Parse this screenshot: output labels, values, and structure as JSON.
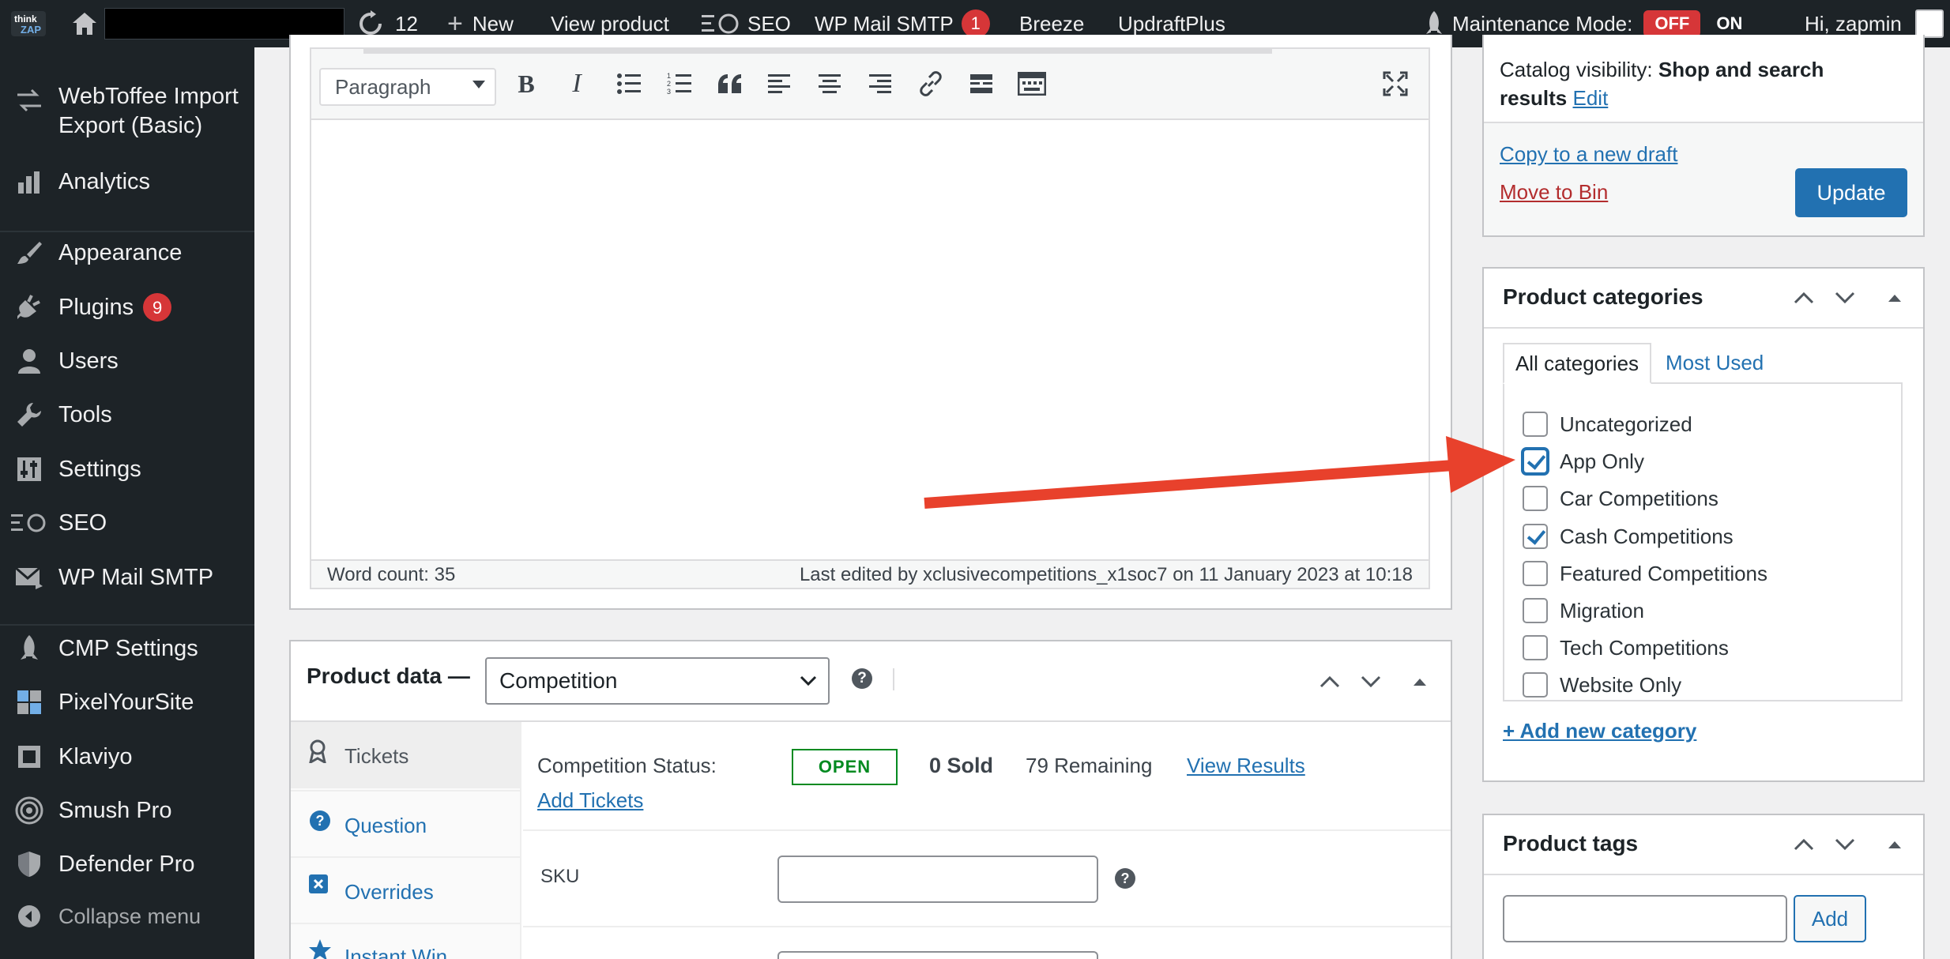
{
  "adminbar": {
    "updates_count": "12",
    "new_label": "New",
    "view_product": "View product",
    "seo": "SEO",
    "wp_mail_smtp": "WP Mail SMTP",
    "smtp_badge": "1",
    "breeze": "Breeze",
    "updraftplus": "UpdraftPlus",
    "maintenance_label": "Maintenance Mode:",
    "maintenance_off": "OFF",
    "maintenance_on": "ON",
    "greeting": "Hi, zapmin"
  },
  "sidebar": {
    "webtoffee_line1": "WebToffee Import",
    "webtoffee_line2": "Export (Basic)",
    "analytics": "Analytics",
    "appearance": "Appearance",
    "plugins": "Plugins",
    "plugins_badge": "9",
    "users": "Users",
    "tools": "Tools",
    "settings": "Settings",
    "seo": "SEO",
    "wp_mail_smtp": "WP Mail SMTP",
    "cmp_settings": "CMP Settings",
    "pixelyoursite": "PixelYourSite",
    "klaviyo": "Klaviyo",
    "smush_pro": "Smush Pro",
    "defender_pro": "Defender Pro",
    "collapse_menu": "Collapse menu"
  },
  "editor": {
    "format_select": "Paragraph",
    "word_count": "Word count: 35",
    "last_edited": "Last edited by xclusivecompetitions_x1soc7 on 11 January 2023 at 10:18"
  },
  "product_data": {
    "title": "Product data —",
    "type_select": "Competition",
    "tabs": {
      "tickets": "Tickets",
      "question": "Question",
      "overrides": "Overrides",
      "instant_win": "Instant Win"
    },
    "competition_status_label": "Competition Status:",
    "status_badge": "OPEN",
    "sold": "0 Sold",
    "remaining": "79 Remaining",
    "view_results": "View Results",
    "add_tickets": "Add Tickets",
    "sku_label": "SKU",
    "sku_value": ""
  },
  "publish": {
    "catalog_visibility_label": "Catalog visibility:",
    "catalog_visibility_value_1": "Shop and search",
    "catalog_visibility_value_2": "results",
    "edit_link": "Edit",
    "copy_draft": "Copy to a new draft",
    "move_to_bin": "Move to Bin",
    "update_button": "Update"
  },
  "categories": {
    "title": "Product categories",
    "tab_all": "All categories",
    "tab_most_used": "Most Used",
    "items": [
      {
        "label": "Uncategorized",
        "checked": false
      },
      {
        "label": "App Only",
        "checked": true
      },
      {
        "label": "Car Competitions",
        "checked": false
      },
      {
        "label": "Cash Competitions",
        "checked": true
      },
      {
        "label": "Featured Competitions",
        "checked": false
      },
      {
        "label": "Migration",
        "checked": false
      },
      {
        "label": "Tech Competitions",
        "checked": false
      },
      {
        "label": "Website Only",
        "checked": false
      }
    ],
    "add_new": "+ Add new category"
  },
  "tags": {
    "title": "Product tags",
    "input_value": "",
    "add_button": "Add"
  },
  "colors": {
    "admin_dark": "#1d2327",
    "link_blue": "#2271b1",
    "danger_red": "#d63638",
    "annotation_red": "#e8412c",
    "status_green": "#008a20"
  },
  "annotation": {
    "arrow": "red-arrow-pointing-to-app-only"
  }
}
